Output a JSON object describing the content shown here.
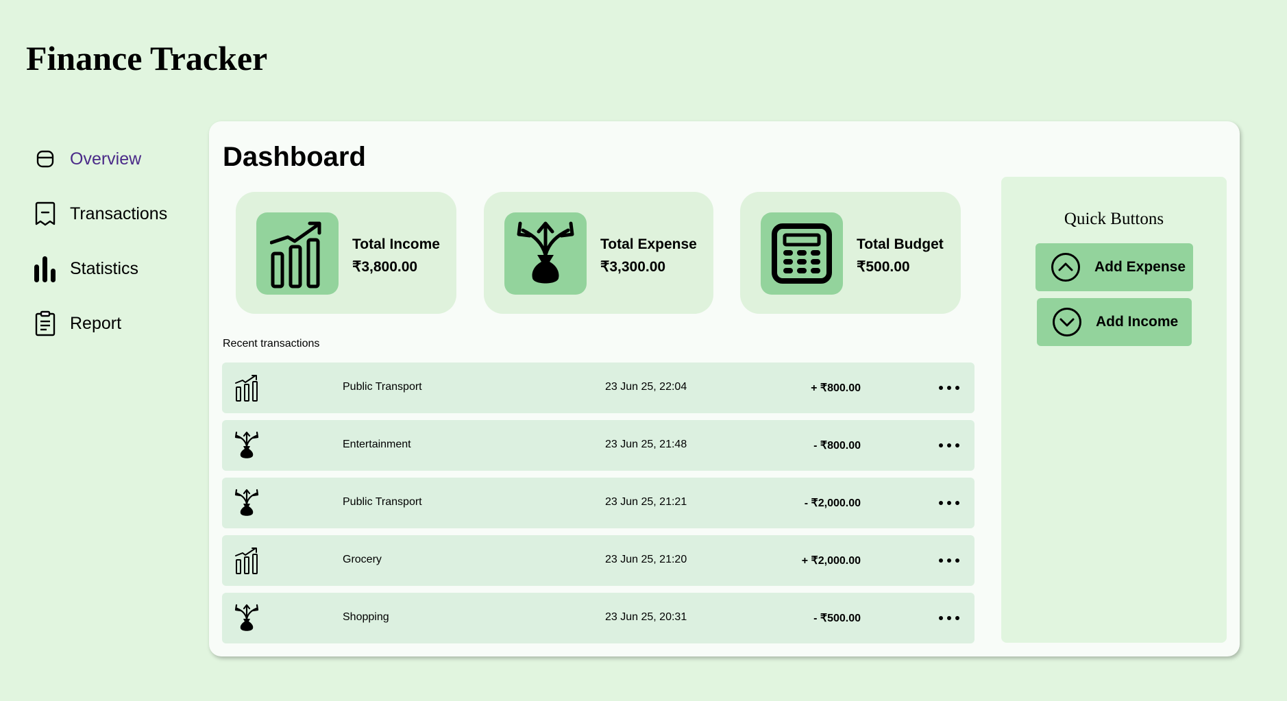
{
  "app": {
    "title": "Finance Tracker"
  },
  "sidebar": {
    "items": [
      {
        "label": "Overview",
        "icon": "overview-icon",
        "active": true
      },
      {
        "label": "Transactions",
        "icon": "receipt-icon"
      },
      {
        "label": "Statistics",
        "icon": "bar-chart-icon"
      },
      {
        "label": "Report",
        "icon": "clipboard-icon"
      }
    ]
  },
  "dashboard": {
    "title": "Dashboard",
    "stats": [
      {
        "label": "Total Income",
        "value": "₹3,800.00",
        "icon": "income-chart-icon"
      },
      {
        "label": "Total Expense",
        "value": "₹3,300.00",
        "icon": "money-bag-arrows-icon"
      },
      {
        "label": "Total Budget",
        "value": "₹500.00",
        "icon": "calculator-icon"
      }
    ],
    "recent_label": "Recent transactions",
    "transactions": [
      {
        "type": "income",
        "category": "Public Transport",
        "date": "23 Jun 25, 22:04",
        "amount": "+ ₹800.00"
      },
      {
        "type": "expense",
        "category": "Entertainment",
        "date": "23 Jun 25, 21:48",
        "amount": "- ₹800.00"
      },
      {
        "type": "expense",
        "category": "Public Transport",
        "date": "23 Jun 25, 21:21",
        "amount": "- ₹2,000.00"
      },
      {
        "type": "income",
        "category": "Grocery",
        "date": "23 Jun 25, 21:20",
        "amount": "+ ₹2,000.00"
      },
      {
        "type": "expense",
        "category": "Shopping",
        "date": "23 Jun 25, 20:31",
        "amount": "- ₹500.00"
      }
    ]
  },
  "quick": {
    "title": "Quick Buttons",
    "add_expense": "Add Expense",
    "add_income": "Add Income"
  },
  "colors": {
    "background": "#e1f5df",
    "card": "#f8fcf8",
    "accent_green": "#93d39c",
    "row_bg": "#dcf0e0",
    "active_nav": "#4a2a88"
  }
}
